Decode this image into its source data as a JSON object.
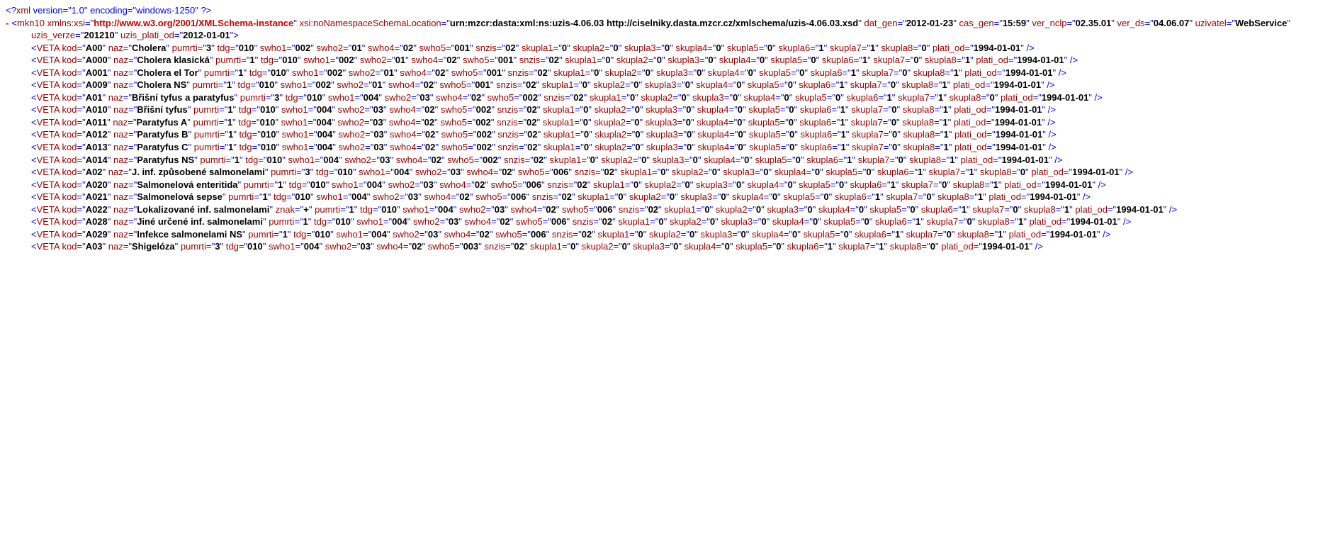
{
  "xml_decl": {
    "version": "1.0",
    "encoding": "windows-1250"
  },
  "root": {
    "name": "mkn10",
    "xmlns_xsi_label": "xmlns:xsi",
    "xmlns_xsi": "http://www.w3.org/2001/XMLSchema-instance",
    "loc_label": "xsi:noNamespaceSchemaLocation",
    "loc": "urn:mzcr:dasta:xml:ns:uzis-4.06.03 http://ciselniky.dasta.mzcr.cz/xmlschema/uzis-4.06.03.xsd",
    "dat_gen": "2012-01-23",
    "cas_gen": "15:59",
    "ver_nclp": "02.35.01",
    "ver_ds": "04.06.07",
    "uzivatel": "WebService",
    "uzis_verze": "201210",
    "uzis_plati_od": "2012-01-01"
  },
  "attr_labels": {
    "kod": "kod",
    "naz": "naz",
    "znak": "znak",
    "pumrti": "pumrti",
    "tdg": "tdg",
    "swho1": "swho1",
    "swho2": "swho2",
    "swho4": "swho4",
    "swho5": "swho5",
    "snzis": "snzis",
    "skupla1": "skupla1",
    "skupla2": "skupla2",
    "skupla3": "skupla3",
    "skupla4": "skupla4",
    "skupla5": "skupla5",
    "skupla6": "skupla6",
    "skupla7": "skupla7",
    "skupla8": "skupla8",
    "plati_od": "plati_od",
    "dat_gen": "dat_gen",
    "cas_gen": "cas_gen",
    "ver_nclp": "ver_nclp",
    "ver_ds": "ver_ds",
    "uzivatel": "uzivatel",
    "uzis_verze": "uzis_verze",
    "uzis_plati_od": "uzis_plati_od"
  },
  "veta_name": "VETA",
  "records": [
    {
      "kod": "A00",
      "naz": "Cholera",
      "pumrti": "3",
      "tdg": "010",
      "swho1": "002",
      "swho2": "01",
      "swho4": "02",
      "swho5": "001",
      "snzis": "02",
      "skupla1": "0",
      "skupla2": "0",
      "skupla3": "0",
      "skupla4": "0",
      "skupla5": "0",
      "skupla6": "1",
      "skupla7": "1",
      "skupla8": "0",
      "plati_od": "1994-01-01"
    },
    {
      "kod": "A000",
      "naz": "Cholera klasická",
      "pumrti": "1",
      "tdg": "010",
      "swho1": "002",
      "swho2": "01",
      "swho4": "02",
      "swho5": "001",
      "snzis": "02",
      "skupla1": "0",
      "skupla2": "0",
      "skupla3": "0",
      "skupla4": "0",
      "skupla5": "0",
      "skupla6": "1",
      "skupla7": "0",
      "skupla8": "1",
      "plati_od": "1994-01-01"
    },
    {
      "kod": "A001",
      "naz": "Cholera el Tor",
      "pumrti": "1",
      "tdg": "010",
      "swho1": "002",
      "swho2": "01",
      "swho4": "02",
      "swho5": "001",
      "snzis": "02",
      "skupla1": "0",
      "skupla2": "0",
      "skupla3": "0",
      "skupla4": "0",
      "skupla5": "0",
      "skupla6": "1",
      "skupla7": "0",
      "skupla8": "1",
      "plati_od": "1994-01-01"
    },
    {
      "kod": "A009",
      "naz": "Cholera NS",
      "pumrti": "1",
      "tdg": "010",
      "swho1": "002",
      "swho2": "01",
      "swho4": "02",
      "swho5": "001",
      "snzis": "02",
      "skupla1": "0",
      "skupla2": "0",
      "skupla3": "0",
      "skupla4": "0",
      "skupla5": "0",
      "skupla6": "1",
      "skupla7": "0",
      "skupla8": "1",
      "plati_od": "1994-01-01"
    },
    {
      "kod": "A01",
      "naz": "Břišní tyfus a paratyfus",
      "pumrti": "3",
      "tdg": "010",
      "swho1": "004",
      "swho2": "03",
      "swho4": "02",
      "swho5": "002",
      "snzis": "02",
      "skupla1": "0",
      "skupla2": "0",
      "skupla3": "0",
      "skupla4": "0",
      "skupla5": "0",
      "skupla6": "1",
      "skupla7": "1",
      "skupla8": "0",
      "plati_od": "1994-01-01"
    },
    {
      "kod": "A010",
      "naz": "Břišní tyfus",
      "pumrti": "1",
      "tdg": "010",
      "swho1": "004",
      "swho2": "03",
      "swho4": "02",
      "swho5": "002",
      "snzis": "02",
      "skupla1": "0",
      "skupla2": "0",
      "skupla3": "0",
      "skupla4": "0",
      "skupla5": "0",
      "skupla6": "1",
      "skupla7": "0",
      "skupla8": "1",
      "plati_od": "1994-01-01"
    },
    {
      "kod": "A011",
      "naz": "Paratyfus A",
      "pumrti": "1",
      "tdg": "010",
      "swho1": "004",
      "swho2": "03",
      "swho4": "02",
      "swho5": "002",
      "snzis": "02",
      "skupla1": "0",
      "skupla2": "0",
      "skupla3": "0",
      "skupla4": "0",
      "skupla5": "0",
      "skupla6": "1",
      "skupla7": "0",
      "skupla8": "1",
      "plati_od": "1994-01-01"
    },
    {
      "kod": "A012",
      "naz": "Paratyfus B",
      "pumrti": "1",
      "tdg": "010",
      "swho1": "004",
      "swho2": "03",
      "swho4": "02",
      "swho5": "002",
      "snzis": "02",
      "skupla1": "0",
      "skupla2": "0",
      "skupla3": "0",
      "skupla4": "0",
      "skupla5": "0",
      "skupla6": "1",
      "skupla7": "0",
      "skupla8": "1",
      "plati_od": "1994-01-01"
    },
    {
      "kod": "A013",
      "naz": "Paratyfus C",
      "pumrti": "1",
      "tdg": "010",
      "swho1": "004",
      "swho2": "03",
      "swho4": "02",
      "swho5": "002",
      "snzis": "02",
      "skupla1": "0",
      "skupla2": "0",
      "skupla3": "0",
      "skupla4": "0",
      "skupla5": "0",
      "skupla6": "1",
      "skupla7": "0",
      "skupla8": "1",
      "plati_od": "1994-01-01"
    },
    {
      "kod": "A014",
      "naz": "Paratyfus NS",
      "pumrti": "1",
      "tdg": "010",
      "swho1": "004",
      "swho2": "03",
      "swho4": "02",
      "swho5": "002",
      "snzis": "02",
      "skupla1": "0",
      "skupla2": "0",
      "skupla3": "0",
      "skupla4": "0",
      "skupla5": "0",
      "skupla6": "1",
      "skupla7": "0",
      "skupla8": "1",
      "plati_od": "1994-01-01"
    },
    {
      "kod": "A02",
      "naz": "J. inf. způsobené salmonelami",
      "pumrti": "3",
      "tdg": "010",
      "swho1": "004",
      "swho2": "03",
      "swho4": "02",
      "swho5": "006",
      "snzis": "02",
      "skupla1": "0",
      "skupla2": "0",
      "skupla3": "0",
      "skupla4": "0",
      "skupla5": "0",
      "skupla6": "1",
      "skupla7": "1",
      "skupla8": "0",
      "plati_od": "1994-01-01"
    },
    {
      "kod": "A020",
      "naz": "Salmonelová enteritida",
      "pumrti": "1",
      "tdg": "010",
      "swho1": "004",
      "swho2": "03",
      "swho4": "02",
      "swho5": "006",
      "snzis": "02",
      "skupla1": "0",
      "skupla2": "0",
      "skupla3": "0",
      "skupla4": "0",
      "skupla5": "0",
      "skupla6": "1",
      "skupla7": "0",
      "skupla8": "1",
      "plati_od": "1994-01-01"
    },
    {
      "kod": "A021",
      "naz": "Salmonelová sepse",
      "pumrti": "1",
      "tdg": "010",
      "swho1": "004",
      "swho2": "03",
      "swho4": "02",
      "swho5": "006",
      "snzis": "02",
      "skupla1": "0",
      "skupla2": "0",
      "skupla3": "0",
      "skupla4": "0",
      "skupla5": "0",
      "skupla6": "1",
      "skupla7": "0",
      "skupla8": "1",
      "plati_od": "1994-01-01"
    },
    {
      "kod": "A022",
      "naz": "Lokalizované inf. salmonelami",
      "znak": "+",
      "pumrti": "1",
      "tdg": "010",
      "swho1": "004",
      "swho2": "03",
      "swho4": "02",
      "swho5": "006",
      "snzis": "02",
      "skupla1": "0",
      "skupla2": "0",
      "skupla3": "0",
      "skupla4": "0",
      "skupla5": "0",
      "skupla6": "1",
      "skupla7": "0",
      "skupla8": "1",
      "plati_od": "1994-01-01"
    },
    {
      "kod": "A028",
      "naz": "Jiné určené inf. salmonelami",
      "pumrti": "1",
      "tdg": "010",
      "swho1": "004",
      "swho2": "03",
      "swho4": "02",
      "swho5": "006",
      "snzis": "02",
      "skupla1": "0",
      "skupla2": "0",
      "skupla3": "0",
      "skupla4": "0",
      "skupla5": "0",
      "skupla6": "1",
      "skupla7": "0",
      "skupla8": "1",
      "plati_od": "1994-01-01"
    },
    {
      "kod": "A029",
      "naz": "Infekce salmonelami NS",
      "pumrti": "1",
      "tdg": "010",
      "swho1": "004",
      "swho2": "03",
      "swho4": "02",
      "swho5": "006",
      "snzis": "02",
      "skupla1": "0",
      "skupla2": "0",
      "skupla3": "0",
      "skupla4": "0",
      "skupla5": "0",
      "skupla6": "1",
      "skupla7": "0",
      "skupla8": "1",
      "plati_od": "1994-01-01"
    },
    {
      "kod": "A03",
      "naz": "Shigelóza",
      "pumrti": "3",
      "tdg": "010",
      "swho1": "004",
      "swho2": "03",
      "swho4": "02",
      "swho5": "003",
      "snzis": "02",
      "skupla1": "0",
      "skupla2": "0",
      "skupla3": "0",
      "skupla4": "0",
      "skupla5": "0",
      "skupla6": "1",
      "skupla7": "1",
      "skupla8": "0",
      "plati_od": "1994-01-01"
    }
  ]
}
